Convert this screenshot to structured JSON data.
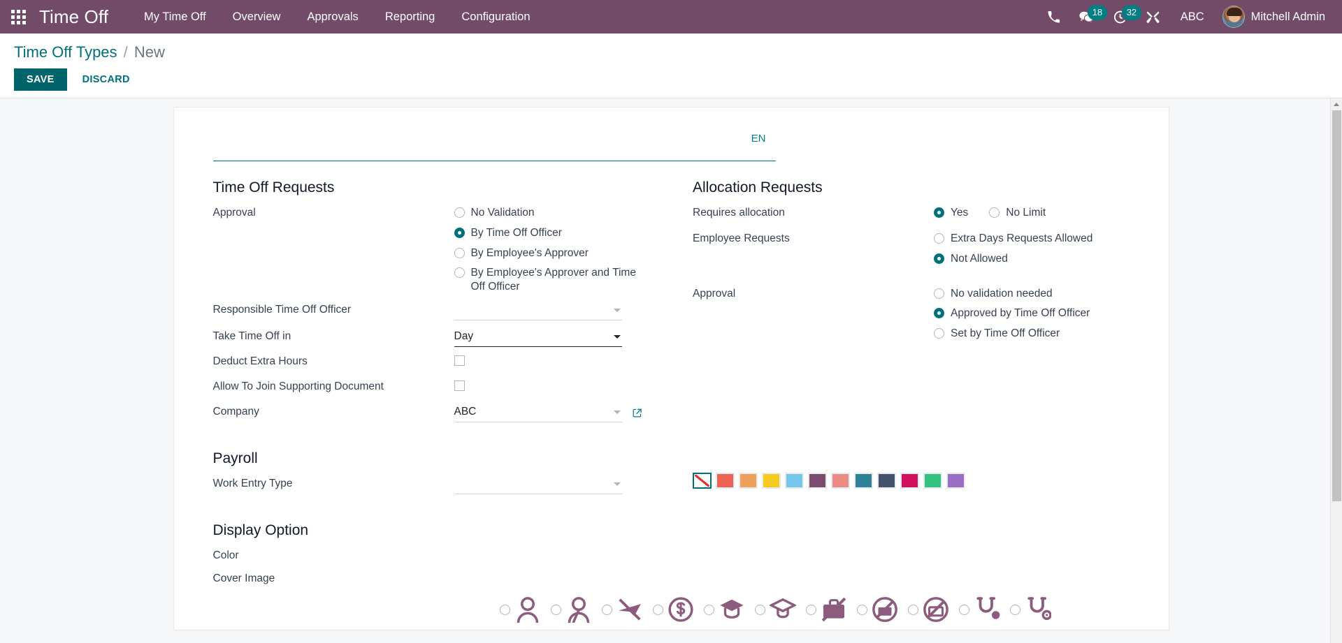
{
  "navbar": {
    "apps_icon": "apps-grid-icon",
    "brand": "Time Off",
    "menus": [
      {
        "label": "My Time Off"
      },
      {
        "label": "Overview"
      },
      {
        "label": "Approvals"
      },
      {
        "label": "Reporting"
      },
      {
        "label": "Configuration"
      }
    ],
    "right": {
      "phone_icon": "phone-icon",
      "messages_icon": "messages-icon",
      "messages_count": "18",
      "activities_icon": "clock-activity-icon",
      "activities_count": "32",
      "tools_icon": "wrench-tools-icon",
      "company": "ABC",
      "avatar_icon": "user-avatar",
      "user_name": "Mitchell Admin"
    },
    "accent_bg": "#714B67",
    "badge_bg": "#017e84"
  },
  "control_panel": {
    "breadcrumb_root": "Time Off Types",
    "breadcrumb_sep": "/",
    "breadcrumb_current": "New",
    "save_label": "SAVE",
    "discard_label": "DISCARD",
    "save_bg": "#00656b"
  },
  "form": {
    "name_value": "",
    "name_placeholder": "",
    "lang_badge": "EN",
    "time_off_requests": {
      "title": "Time Off Requests",
      "approval": {
        "label": "Approval",
        "options": [
          {
            "label": "No Validation",
            "selected": false
          },
          {
            "label": "By Time Off Officer",
            "selected": true
          },
          {
            "label": "By Employee's Approver",
            "selected": false
          },
          {
            "label": "By Employee's Approver and Time Off Officer",
            "selected": false
          }
        ]
      },
      "responsible_officer": {
        "label": "Responsible Time Off Officer",
        "value": ""
      },
      "take_time_off_in": {
        "label": "Take Time Off in",
        "value": "Day"
      },
      "deduct_extra_hours": {
        "label": "Deduct Extra Hours",
        "checked": false
      },
      "allow_supporting_doc": {
        "label": "Allow To Join Supporting Document",
        "checked": false
      },
      "company": {
        "label": "Company",
        "value": "ABC",
        "link_icon": "external-link-icon"
      }
    },
    "allocation_requests": {
      "title": "Allocation Requests",
      "requires_allocation": {
        "label": "Requires allocation",
        "options": [
          {
            "label": "Yes",
            "selected": true
          },
          {
            "label": "No Limit",
            "selected": false
          }
        ]
      },
      "employee_requests": {
        "label": "Employee Requests",
        "options": [
          {
            "label": "Extra Days Requests Allowed",
            "selected": false
          },
          {
            "label": "Not Allowed",
            "selected": true
          }
        ]
      },
      "approval": {
        "label": "Approval",
        "options": [
          {
            "label": "No validation needed",
            "selected": false
          },
          {
            "label": "Approved by Time Off Officer",
            "selected": true
          },
          {
            "label": "Set by Time Off Officer",
            "selected": false
          }
        ]
      }
    },
    "payroll": {
      "title": "Payroll",
      "work_entry_type": {
        "label": "Work Entry Type",
        "value": ""
      }
    },
    "display_option": {
      "title": "Display Option",
      "color": {
        "label": "Color",
        "selected_index": 0,
        "swatches": [
          {
            "name": "no-color",
            "hex": ""
          },
          {
            "name": "red",
            "hex": "#ec6355"
          },
          {
            "name": "orange",
            "hex": "#eda martin"
          },
          {
            "name": "yellow",
            "hex": "#f5cb1f"
          },
          {
            "name": "light-blue",
            "hex": "#74c7ea"
          },
          {
            "name": "purple",
            "hex": "#7a4d6e"
          },
          {
            "name": "salmon",
            "hex": "#eb8b85"
          },
          {
            "name": "teal",
            "hex": "#2f8099"
          },
          {
            "name": "navy-slate",
            "hex": "#46516e"
          },
          {
            "name": "magenta",
            "hex": "#d3105f"
          },
          {
            "name": "green",
            "hex": "#35c17f"
          },
          {
            "name": "violet",
            "hex": "#9a6ec4"
          }
        ]
      },
      "cover_image": {
        "label": "Cover Image",
        "options": [
          {
            "icon": "person-icon",
            "selected": false
          },
          {
            "icon": "person-alt-icon",
            "selected": false
          },
          {
            "icon": "plane-slash-icon",
            "selected": false
          },
          {
            "icon": "money-circle-icon",
            "selected": false
          },
          {
            "icon": "graduation-cap-icon",
            "selected": false
          },
          {
            "icon": "graduation-cap-alt-icon",
            "selected": false
          },
          {
            "icon": "briefcase-slash-icon",
            "selected": false
          },
          {
            "icon": "no-briefcase-circle-icon",
            "selected": false
          },
          {
            "icon": "no-briefcase-circle-alt-icon",
            "selected": false
          },
          {
            "icon": "stethoscope-icon",
            "selected": false
          },
          {
            "icon": "stethoscope-alt-icon",
            "selected": false
          }
        ]
      }
    }
  },
  "scrollbar": {
    "up_arrow_icon": "scroll-up-arrow-icon"
  }
}
